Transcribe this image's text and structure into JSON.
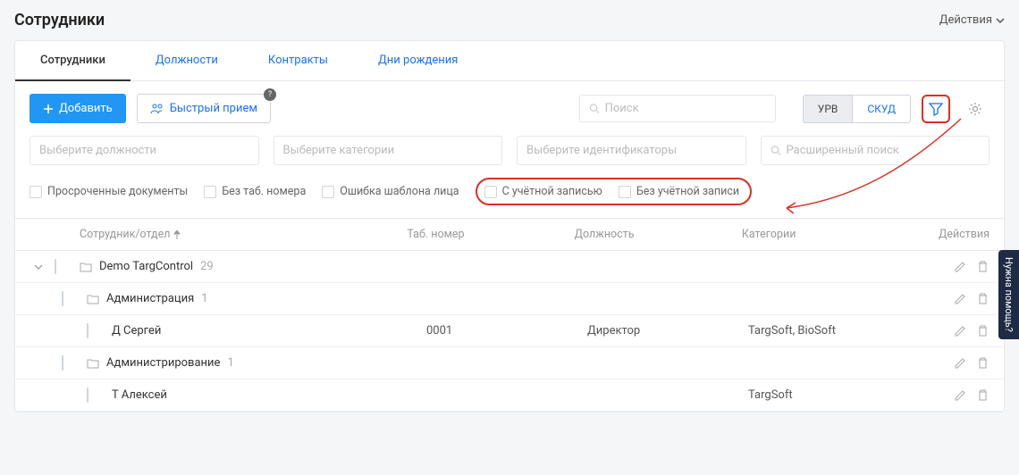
{
  "header": {
    "title": "Сотрудники",
    "actions_label": "Действия"
  },
  "tabs": {
    "employees": "Сотрудники",
    "positions": "Должности",
    "contracts": "Контракты",
    "birthdays": "Дни рождения"
  },
  "toolbar": {
    "add_label": "Добавить",
    "quick_hire_label": "Быстрый прием",
    "search_placeholder": "Поиск",
    "urv_label": "УРВ",
    "skud_label": "СКУД"
  },
  "filters": {
    "positions_placeholder": "Выберите должности",
    "categories_placeholder": "Выберите категории",
    "identifiers_placeholder": "Выберите идентификаторы",
    "advanced_placeholder": "Расширенный поиск"
  },
  "checks": {
    "expired_docs": "Просроченные документы",
    "no_tab_number": "Без таб. номера",
    "face_template_error": "Ошибка шаблона лица",
    "with_account": "С учётной записью",
    "without_account": "Без учётной записи"
  },
  "table": {
    "col_employee": "Сотрудник/отдел",
    "col_tab": "Таб. номер",
    "col_position": "Должность",
    "col_categories": "Категории",
    "col_actions": "Действия"
  },
  "rows": {
    "r0_name": "Demo TargControl",
    "r0_count": "29",
    "r1_name": "Администрация",
    "r1_count": "1",
    "r2_name": "Д Сергей",
    "r2_tab": "0001",
    "r2_pos": "Директор",
    "r2_cat": "TargSoft, BioSoft",
    "r3_name": "Администрирование",
    "r3_count": "1",
    "r4_name": "Т Алексей",
    "r4_cat": "TargSoft"
  },
  "help_tab": "Нужна помощь?"
}
